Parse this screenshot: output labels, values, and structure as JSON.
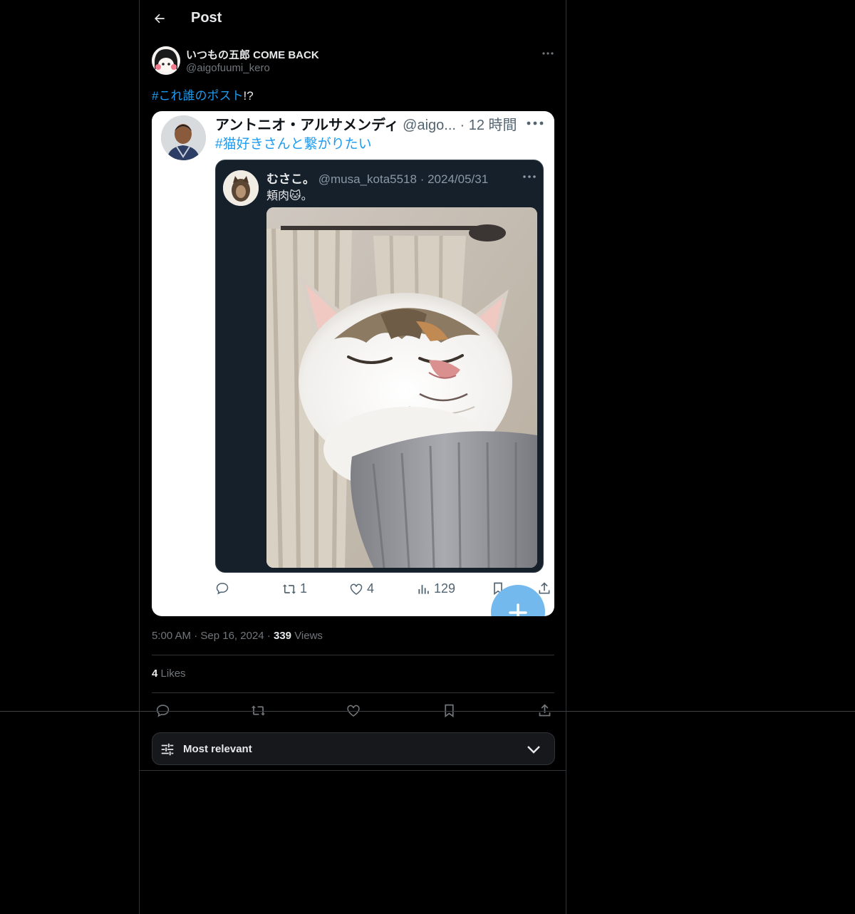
{
  "header": {
    "title": "Post"
  },
  "author": {
    "name": "いつもの五郎 COME BACK",
    "handle": "@aigofuumi_kero"
  },
  "post": {
    "hashtag": "#これ誰のポスト",
    "suffix": "!?"
  },
  "embedded": {
    "name": "アントニオ・アルサメンディ",
    "meta": "@aigo... · 12 時間",
    "hashtag": "#猫好きさんと繋がりたい",
    "quoted": {
      "name": "むさこ。",
      "meta": "@musa_kota5518 · 2024/05/31",
      "text": "頬肉🐱。"
    },
    "actions": {
      "retweets": "1",
      "likes": "4",
      "views": "129"
    }
  },
  "meta": {
    "time": "5:00 AM",
    "date": "Sep 16, 2024",
    "views_count": "339",
    "views_label": "Views"
  },
  "likes": {
    "count": "4",
    "label": "Likes"
  },
  "sort": {
    "label": "Most relevant"
  },
  "colors": {
    "accent": "#1d9bf0",
    "background": "#000000",
    "secondary_text": "#71767b"
  }
}
